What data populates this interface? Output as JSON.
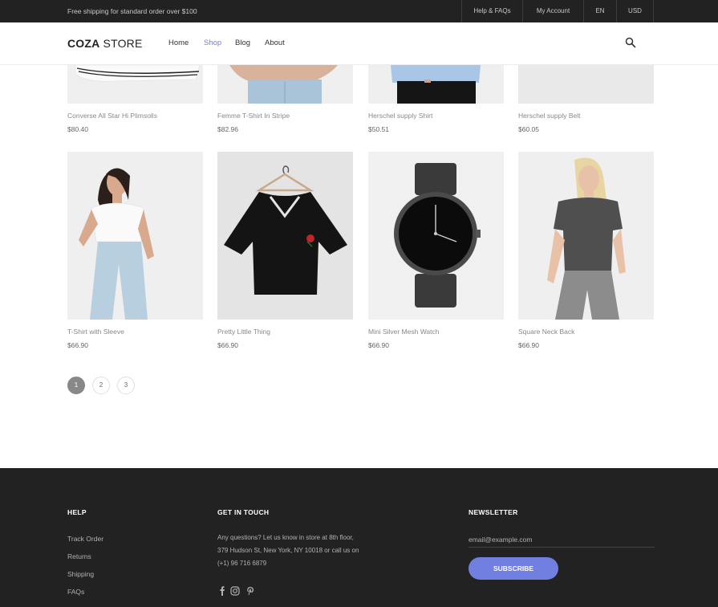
{
  "topbar": {
    "promo": "Free shipping for standard order over $100",
    "links": [
      "Help & FAQs",
      "My Account",
      "EN",
      "USD"
    ]
  },
  "header": {
    "logo_bold": "COZA",
    "logo_light": " STORE",
    "nav": [
      "Home",
      "Shop",
      "Blog",
      "About"
    ],
    "active_nav": "Shop"
  },
  "products_row1": [
    {
      "name": "Converse All Star Hi Plimsolls",
      "price": "$80.40"
    },
    {
      "name": "Femme T-Shirt In Stripe",
      "price": "$82.96"
    },
    {
      "name": "Herschel supply Shirt",
      "price": "$50.51"
    },
    {
      "name": "Herschel supply Belt",
      "price": "$60.05"
    }
  ],
  "products_row2": [
    {
      "name": "T-Shirt with Sleeve",
      "price": "$66.90"
    },
    {
      "name": "Pretty Little Thing",
      "price": "$66.90"
    },
    {
      "name": "Mini Silver Mesh Watch",
      "price": "$66.90"
    },
    {
      "name": "Square Neck Back",
      "price": "$66.90"
    }
  ],
  "pagination": {
    "pages": [
      "1",
      "2",
      "3"
    ],
    "current": "1"
  },
  "footer": {
    "help": {
      "title": "HELP",
      "links": [
        "Track Order",
        "Returns",
        "Shipping",
        "FAQs"
      ]
    },
    "contact": {
      "title": "GET IN TOUCH",
      "text": "Any questions? Let us know in store at 8th floor, 379 Hudson St, New York, NY 10018 or call us on (+1) 96 716 6879",
      "social_icons": [
        "facebook-icon",
        "instagram-icon",
        "pinterest-icon"
      ]
    },
    "newsletter": {
      "title": "NEWSLETTER",
      "placeholder": "email@example.com",
      "button": "SUBSCRIBE"
    }
  },
  "colors": {
    "accent": "#717fe0",
    "dark": "#222222"
  }
}
